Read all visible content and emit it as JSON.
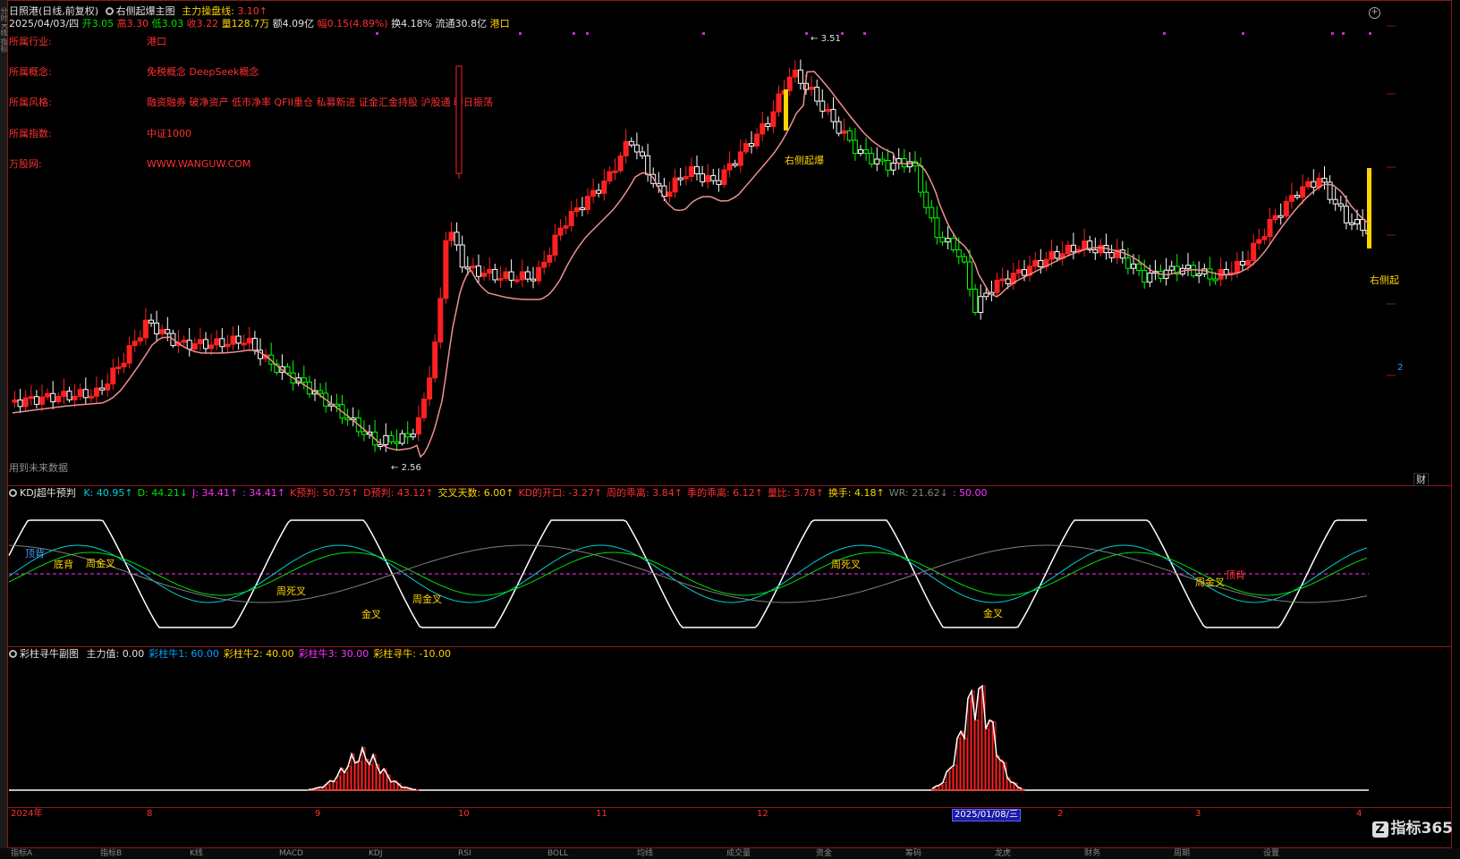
{
  "main": {
    "line1": {
      "stock": "日照港(日线,前复权)",
      "indicator": "右侧起爆主图",
      "main_op_label": "主力操盘线:",
      "main_op_value": "3.10↑"
    },
    "line2": {
      "date": "2025/04/03/四",
      "open_label": "开",
      "open": "3.05",
      "high_label": "高",
      "high": "3.30",
      "low_label": "低",
      "low": "3.03",
      "close_label": "收",
      "close": "3.22",
      "vol_label": "量",
      "vol": "128.7万",
      "amt_label": "额",
      "amt": "4.09亿",
      "chg_label": "幅",
      "chg": "0.15(4.89%)",
      "turn_label": "换",
      "turn": "4.18%",
      "float_label": "流通",
      "float": "30.8亿",
      "region": "港口"
    },
    "info": [
      {
        "k": "所属行业:",
        "v": "港口"
      },
      {
        "k": "所属概念:",
        "v": "免税概念 DeepSeek概念"
      },
      {
        "k": "所属风格:",
        "v": "融资融券 破净资产 低市净率 QFII重仓 私募新进 证金汇金持股 沪股通 昨日振荡"
      },
      {
        "k": "所属指数:",
        "v": "中证1000"
      },
      {
        "k": "万股网:",
        "v": "WWW.WANGUW.COM"
      }
    ],
    "high_mark": "3.51",
    "low_mark": "2.56",
    "signal_label": "右侧起爆",
    "signal_label_right": "右侧起",
    "future_note": "用到未来数据",
    "cai": "财",
    "right_axis_tag": "2"
  },
  "kdj": {
    "title": "KDJ超牛预判",
    "items": [
      {
        "label": "K:",
        "value": "40.95↑",
        "color": "#00d0d0"
      },
      {
        "label": "D:",
        "value": "44.21↓",
        "color": "#00e000"
      },
      {
        "label": "J:",
        "value": "34.41↑",
        "color": "#ff30ff"
      },
      {
        "label": ":",
        "value": "34.41↑",
        "color": "#ff30ff"
      },
      {
        "label": "K预判:",
        "value": "50.75↑",
        "color": "#ff3030"
      },
      {
        "label": "D预判:",
        "value": "43.12↑",
        "color": "#ff3030"
      },
      {
        "label": "交叉天数:",
        "value": "6.00↑",
        "color": "#ffd400"
      },
      {
        "label": "KD的开口:",
        "value": "-3.27↑",
        "color": "#ff3030"
      },
      {
        "label": "周的乖离:",
        "value": "3.84↑",
        "color": "#ff3030"
      },
      {
        "label": "季的乖离:",
        "value": "6.12↑",
        "color": "#ff3030"
      },
      {
        "label": "量比:",
        "value": "3.78↑",
        "color": "#ff3030"
      },
      {
        "label": "换手:",
        "value": "4.18↑",
        "color": "#ffd400"
      },
      {
        "label": "WR:",
        "value": "21.62↓",
        "color": "#808080"
      },
      {
        "label": ":",
        "value": "50.00",
        "color": "#ff30ff"
      }
    ],
    "labels": [
      "顶背",
      "底背",
      "周金叉",
      "周死叉",
      "金叉",
      "周金叉",
      "周死叉",
      "金叉",
      "周金叉",
      "顶背"
    ]
  },
  "cai_panel": {
    "title": "彩柱寻牛副图",
    "items": [
      {
        "label": "主力值:",
        "value": "0.00",
        "color": "#e0e0e0"
      },
      {
        "label": "彩柱牛1:",
        "value": "60.00",
        "color": "#00a0ff"
      },
      {
        "label": "彩柱牛2:",
        "value": "40.00",
        "color": "#ffd400"
      },
      {
        "label": "彩柱牛3:",
        "value": "30.00",
        "color": "#ff30ff"
      },
      {
        "label": "彩柱寻牛:",
        "value": "-10.00",
        "color": "#ffd400"
      }
    ]
  },
  "xaxis": {
    "labels": [
      "2024年",
      "8",
      "9",
      "10",
      "11",
      "12",
      "2025/01/08/三",
      "2",
      "3",
      "4"
    ]
  },
  "bottom_tabs": [
    "指标A",
    "指标B",
    "K线",
    "MACD",
    "KDJ",
    "RSI",
    "BOLL",
    "均线",
    "成交量",
    "资金",
    "筹码",
    "龙虎",
    "财务",
    "周期",
    "设置"
  ],
  "logo": {
    "mark": "Z",
    "text": "指标365"
  }
}
